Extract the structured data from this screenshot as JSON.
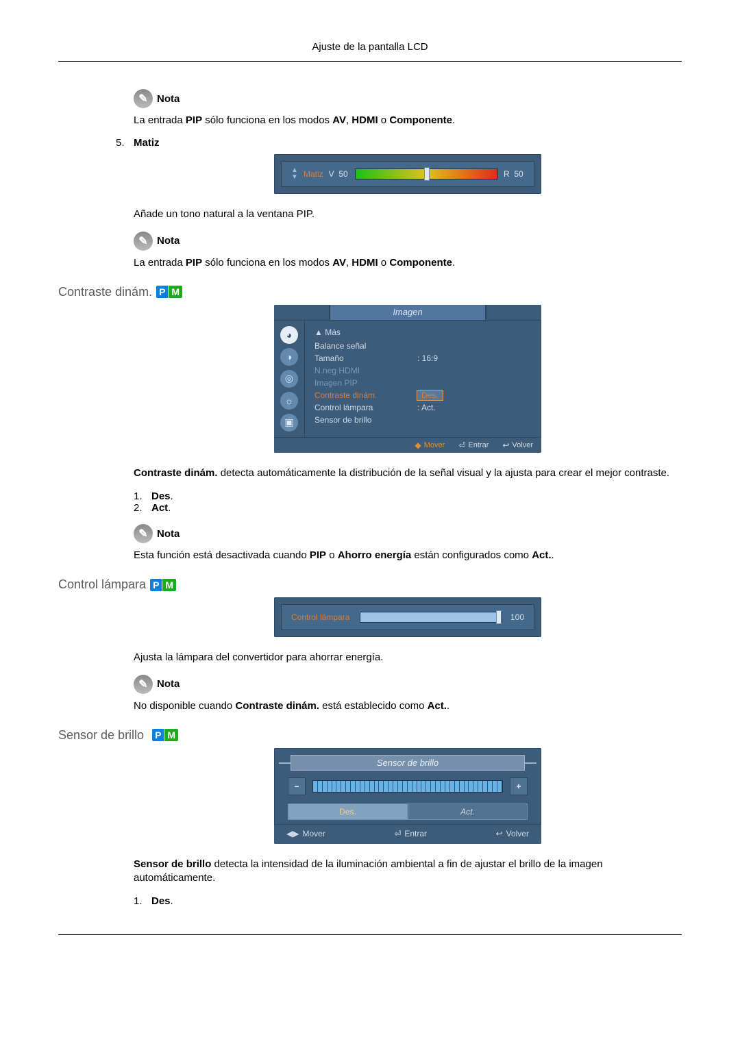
{
  "header": "Ajuste de la pantalla LCD",
  "note_label": "Nota",
  "pip_note": {
    "p1": "La entrada ",
    "b1": "PIP",
    "p2": " sólo funciona en los modos ",
    "b2": "AV",
    "p3": ", ",
    "b3": "HDMI",
    "p4": " o ",
    "b4": "Componente",
    "p5": "."
  },
  "item5": {
    "num": "5.",
    "title": "Matiz"
  },
  "matiz_osd": {
    "label": "Matiz",
    "left_letter": "V",
    "left_val": "50",
    "right_letter": "R",
    "right_val": "50"
  },
  "matiz_desc": "Añade un tono natural a la ventana PIP.",
  "sec_contraste": "Contraste dinám.",
  "menu": {
    "title": "Imagen",
    "head": "▲ Más",
    "rows": {
      "r1k": "Balance señal",
      "r1v": "",
      "r2k": "Tamaño",
      "r2v": "16:9",
      "r3k": "N.neg HDMI",
      "r3v": "",
      "r4k": "Imagen PIP",
      "r4v": "",
      "r5k": "Contraste dinám.",
      "r5v": "Des.",
      "r6k": "Control lámpara",
      "r6v": "Act.",
      "r7k": "Sensor de brillo",
      "r7v": ""
    },
    "footer": {
      "mover": "Mover",
      "entrar": "Entrar",
      "volver": "Volver"
    }
  },
  "contraste_desc": {
    "b1": "Contraste dinám.",
    "rest": " detecta automáticamente la distribución de la señal visual y la ajusta para crear el mejor contraste."
  },
  "contraste_list": {
    "n1": "1.",
    "v1": "Des",
    "n2": "2.",
    "v2": "Act",
    "dot": "."
  },
  "contraste_note": {
    "p1": "Esta función está desactivada cuando ",
    "b1": "PIP",
    "p2": " o ",
    "b2": "Ahorro energía",
    "p3": " están configurados como ",
    "b3": "Act.",
    "p4": "."
  },
  "sec_control_lampara": "Control lámpara",
  "cl_osd": {
    "label": "Control lámpara",
    "value": "100"
  },
  "cl_desc": "Ajusta la lámpara del convertidor para ahorrar energía.",
  "cl_note": {
    "p1": "No disponible cuando ",
    "b1": "Contraste dinám.",
    "p2": " está establecido como ",
    "b2": "Act.",
    "p3": "."
  },
  "sec_sensor": "Sensor de brillo",
  "sb_osd": {
    "title": "Sensor de brillo",
    "minus": "−",
    "plus": "+",
    "tab_des": "Des.",
    "tab_act": "Act.",
    "mover": "Mover",
    "entrar": "Entrar",
    "volver": "Volver"
  },
  "sb_desc": {
    "b1": "Sensor de brillo",
    "rest": " detecta la intensidad de la iluminación ambiental a fin de ajustar el brillo de la imagen automáticamente."
  },
  "sb_list": {
    "n1": "1.",
    "v1": "Des",
    "dot": "."
  },
  "pm": {
    "p": "P",
    "m": "M"
  }
}
